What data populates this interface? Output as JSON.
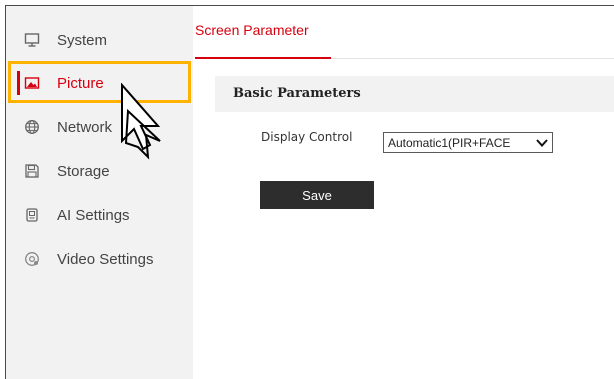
{
  "sidebar": {
    "items": [
      {
        "label": "System",
        "icon": "monitor-icon",
        "active": false
      },
      {
        "label": "Picture",
        "icon": "picture-icon",
        "active": true
      },
      {
        "label": "Network",
        "icon": "globe-icon",
        "active": false
      },
      {
        "label": "Storage",
        "icon": "floppy-disk-icon",
        "active": false
      },
      {
        "label": "AI Settings",
        "icon": "ai-chip-icon",
        "active": false
      },
      {
        "label": "Video Settings",
        "icon": "video-settings-icon",
        "active": false
      }
    ]
  },
  "main": {
    "tab_label": "Screen Parameter",
    "section_title": "Basic Parameters",
    "display_control": {
      "label": "Display Control",
      "value": "Automatic1(PIR+FACE"
    },
    "save_label": "Save"
  },
  "colors": {
    "accent": "#d7000f",
    "highlight": "#ffb300",
    "button": "#2d2d2d",
    "sidebar_bg": "#f2f2f2"
  }
}
